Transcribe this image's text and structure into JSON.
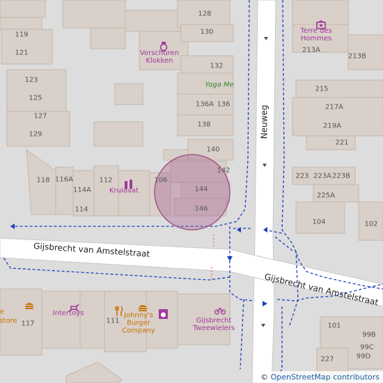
{
  "streets": {
    "neuweg": "Neuweg",
    "gijsbrecht_west": "Gijsbrecht van Amstelstraat",
    "gijsbrecht_east": "Gijsbrecht van Amstelstraat"
  },
  "house_numbers": {
    "n128": "128",
    "n130": "130",
    "n132": "132",
    "n136a": "136A",
    "n136": "136",
    "n138": "138",
    "n140": "140",
    "n142": "142",
    "n144": "144",
    "n146": "146",
    "n119": "119",
    "n121": "121",
    "n123": "123",
    "n125": "125",
    "n127": "127",
    "n129": "129",
    "n118": "118",
    "n116a": "116A",
    "n114a": "114A",
    "n114": "114",
    "n112": "112",
    "n106": "106",
    "n213a": "213A",
    "n213b": "213B",
    "n215": "215",
    "n217a": "217A",
    "n219a": "219A",
    "n221": "221",
    "n223": "223",
    "n223a": "223A",
    "n223b": "223B",
    "n225a": "225A",
    "n104": "104",
    "n102": "102",
    "n117": "117",
    "n111": "111",
    "n101": "101",
    "n99b": "99B",
    "n99c": "99C",
    "n99d": "99D",
    "n227": "227"
  },
  "pois": {
    "verschuren": "Verschuren\nKlokken",
    "yoga": "Yoga Me",
    "kruidvat": "Kruidvat",
    "terre": "Terre des\nHommes",
    "intertoys": "Intertoys",
    "johnnys": "Johnny's\nBurger\nCompany",
    "tweewielers": "Gijsbrecht\nTweewielers",
    "store_partial": "store",
    "store_partial_e": "e"
  },
  "icons": {
    "verschuren": "watch-icon",
    "kruidvat": "pharmacy-icon",
    "terre": "shop-bag-icon",
    "intertoys": "toy-horse-icon",
    "johnnys_food": "restaurant-icon",
    "johnnys_burger": "burger-icon",
    "laundry": "laundry-icon",
    "tweewielers": "bicycle-icon",
    "store_burger": "burger-icon"
  },
  "colors": {
    "road": "#ffffff",
    "road_edge": "#c8c8c8",
    "building": "#d9d0c9",
    "building_edge": "#c4b6ab",
    "background": "#dddddd",
    "footway": "#1e3fc0",
    "crossing": "#f08060",
    "highlight": "#a0568a",
    "poi_purple": "#a03a9b",
    "poi_orange": "#c77400"
  },
  "attribution": {
    "symbol": "©",
    "text": "OpenStreetMap contributors"
  }
}
